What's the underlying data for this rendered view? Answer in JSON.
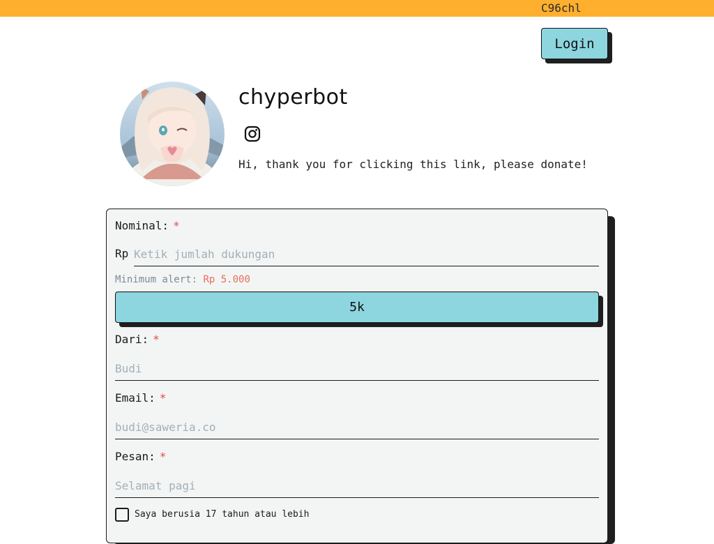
{
  "topbar": {
    "code": "C96chl",
    "color": "#ffaf2e"
  },
  "header": {
    "login_label": "Login"
  },
  "profile": {
    "name": "chyperbot",
    "social_icon": "instagram-icon",
    "bio": "Hi, thank you for clicking this link, please donate!"
  },
  "form": {
    "nominal": {
      "label": "Nominal:",
      "required_mark": "*",
      "prefix": "Rp",
      "placeholder": "Ketik jumlah dukungan",
      "value": ""
    },
    "min_alert": {
      "label": "Minimum alert:",
      "amount": "Rp 5.000"
    },
    "preset": {
      "label": "5k"
    },
    "dari": {
      "label": "Dari:",
      "required_mark": "*",
      "placeholder": "Budi",
      "value": ""
    },
    "email": {
      "label": "Email:",
      "required_mark": "*",
      "placeholder": "budi@saweria.co",
      "value": ""
    },
    "pesan": {
      "label": "Pesan:",
      "required_mark": "*",
      "placeholder": "Selamat pagi",
      "value": ""
    },
    "age_check": {
      "label": "Saya berusia 17 tahun atau lebih",
      "checked": false
    }
  },
  "colors": {
    "accent": "#8dd5df",
    "required": "#e04b4b",
    "card_bg": "#f2f5f4",
    "min_amount": "#e6705a"
  }
}
